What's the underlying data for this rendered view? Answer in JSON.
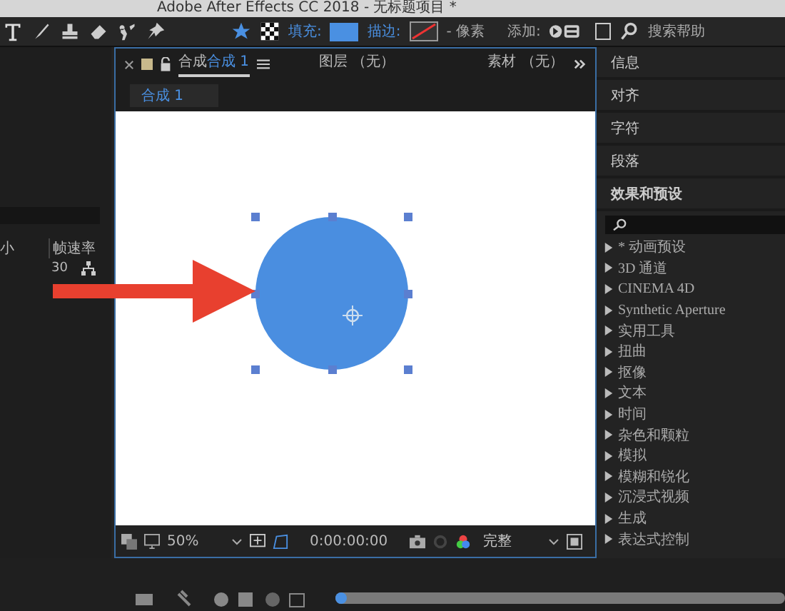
{
  "title_bar": {
    "title": "Adobe After Effects CC 2018 - 无标题项目 *"
  },
  "toolbar": {
    "fill_label": "填充:",
    "stroke_label": "描边:",
    "stroke_unit": "- 像素",
    "add_label": "添加:",
    "search_help": "搜索帮助",
    "snap_checked": false
  },
  "project_panel": {
    "columns": [
      "小",
      "帧速率"
    ],
    "rows": [
      {
        "column_2": "30"
      }
    ]
  },
  "comp_panel": {
    "tabs": [
      {
        "label": "合成",
        "name": "合成 1",
        "selected": true
      },
      {
        "label": "图层 （无）",
        "selected": false
      },
      {
        "label": "素材 （无）",
        "selected": false
      }
    ],
    "sub_tab": "合成 1",
    "zoom": "50%",
    "timecode": "0:00:00:00",
    "resolution": "完整"
  },
  "right_panel": {
    "panels": [
      "信息",
      "对齐",
      "字符",
      "段落"
    ],
    "effects_title": "效果和预设",
    "effects": [
      {
        "label": "* 动画预设",
        "expanded": false
      },
      {
        "label": "3D 通道",
        "expanded": false
      },
      {
        "label": "CINEMA 4D",
        "expanded": false
      },
      {
        "label": "Synthetic Aperture",
        "expanded": false
      },
      {
        "label": "实用工具",
        "expanded": false
      },
      {
        "label": "扭曲",
        "expanded": false
      },
      {
        "label": "抠像",
        "expanded": false
      },
      {
        "label": "文本",
        "expanded": false
      },
      {
        "label": "时间",
        "expanded": false
      },
      {
        "label": "杂色和颗粒",
        "expanded": false
      },
      {
        "label": "模拟",
        "expanded": false
      },
      {
        "label": "模糊和锐化",
        "expanded": false
      },
      {
        "label": "沉浸式视频",
        "expanded": false
      },
      {
        "label": "生成",
        "expanded": false
      },
      {
        "label": "表达式控制",
        "expanded": false
      }
    ]
  }
}
